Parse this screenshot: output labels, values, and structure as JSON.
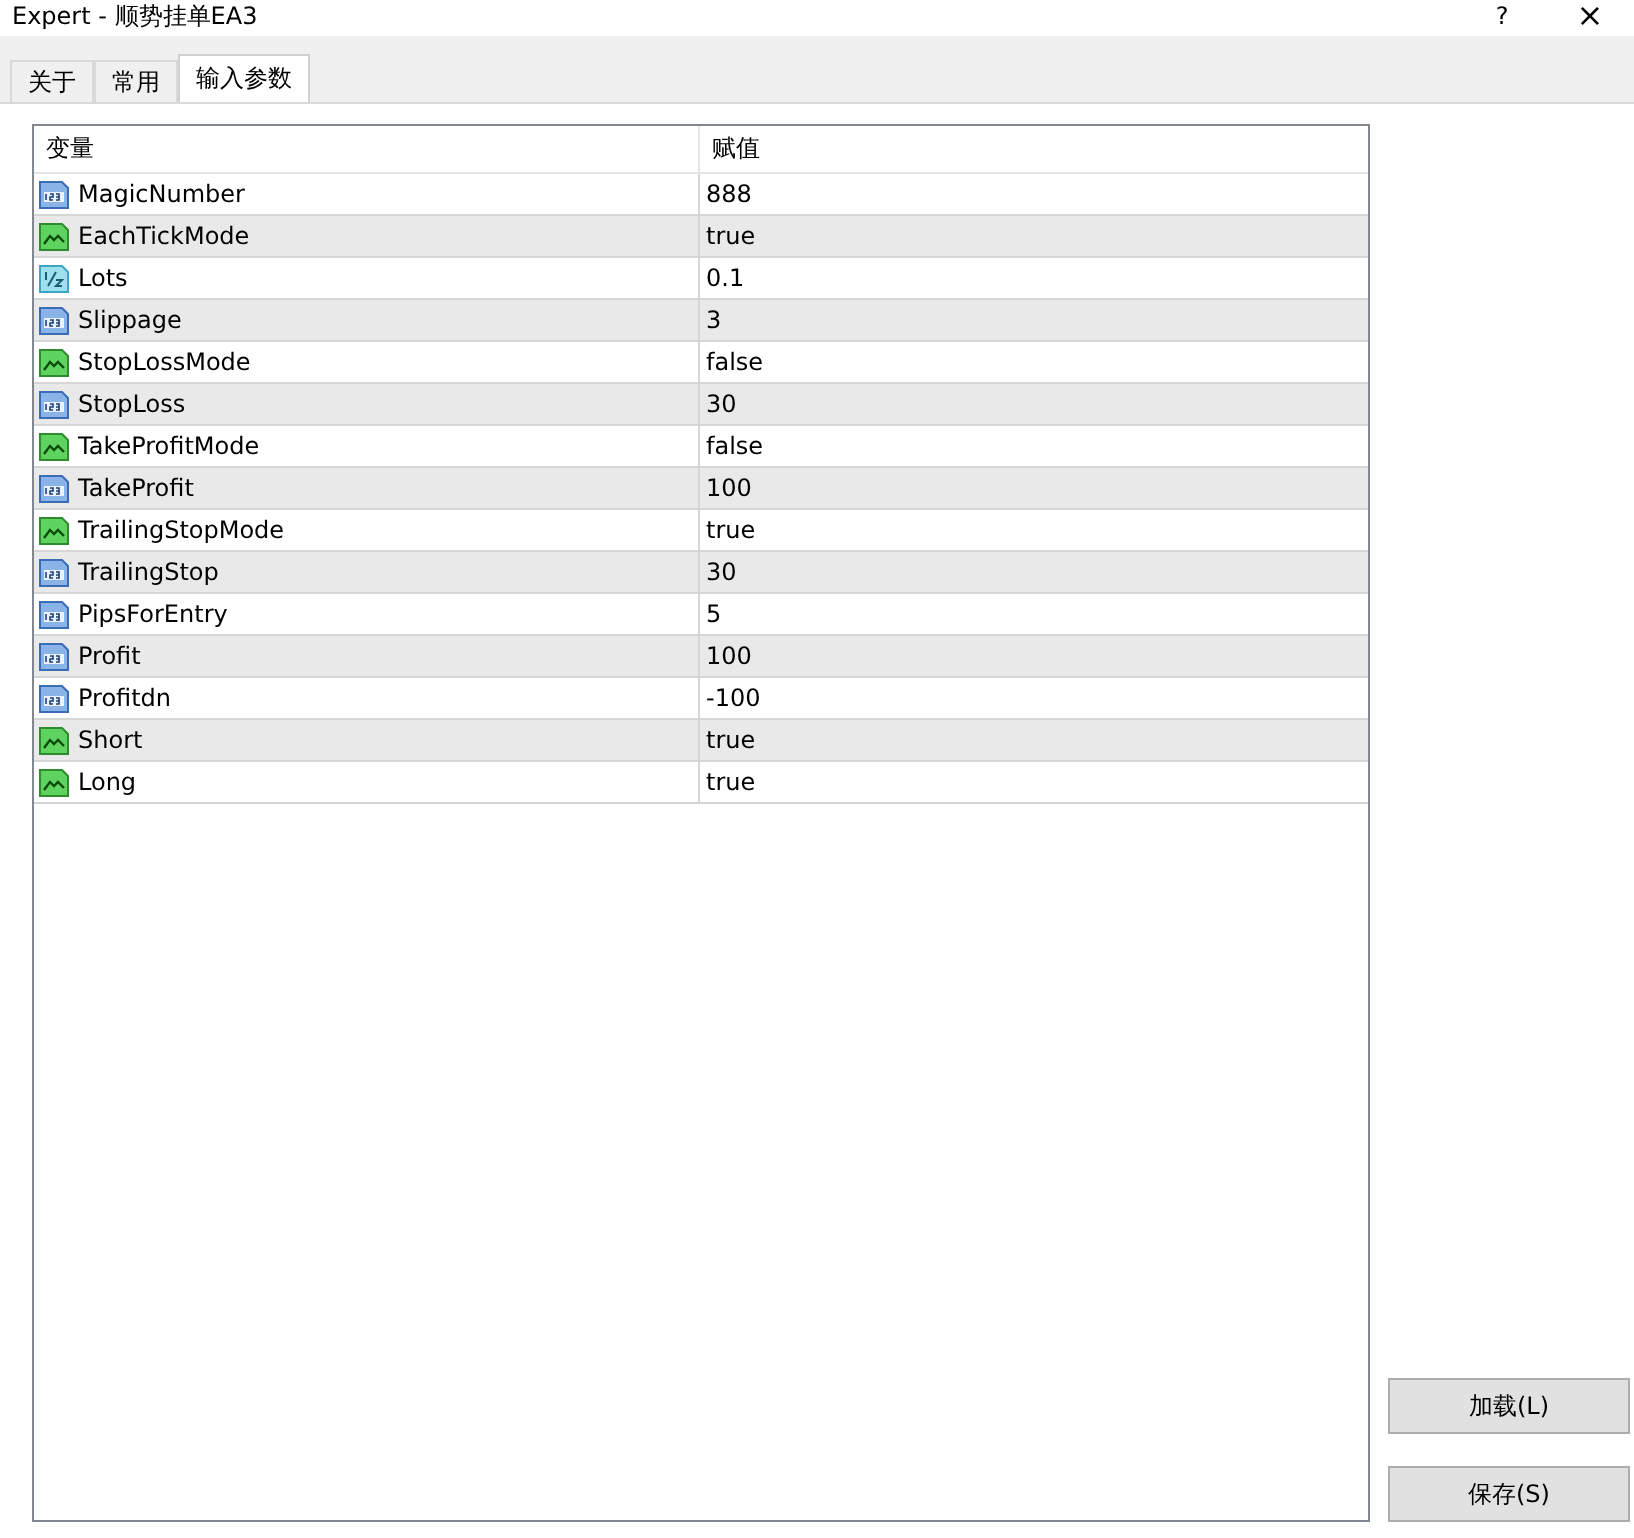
{
  "window": {
    "title": "Expert - 顺势挂单EA3",
    "help": "?",
    "close": "×"
  },
  "tabs": [
    {
      "label": "关于",
      "selected": false
    },
    {
      "label": "常用",
      "selected": false
    },
    {
      "label": "输入参数",
      "selected": true
    }
  ],
  "table": {
    "columns": [
      "变量",
      "赋值"
    ],
    "rows": [
      {
        "kind": "int",
        "name": "MagicNumber",
        "value": "888"
      },
      {
        "kind": "bool",
        "name": "EachTickMode",
        "value": "true"
      },
      {
        "kind": "double",
        "name": "Lots",
        "value": "0.1"
      },
      {
        "kind": "int",
        "name": "Slippage",
        "value": "3"
      },
      {
        "kind": "bool",
        "name": "StopLossMode",
        "value": "false"
      },
      {
        "kind": "int",
        "name": "StopLoss",
        "value": "30"
      },
      {
        "kind": "bool",
        "name": "TakeProfitMode",
        "value": "false"
      },
      {
        "kind": "int",
        "name": "TakeProfit",
        "value": "100"
      },
      {
        "kind": "bool",
        "name": "TrailingStopMode",
        "value": "true"
      },
      {
        "kind": "int",
        "name": "TrailingStop",
        "value": "30"
      },
      {
        "kind": "int",
        "name": "PipsForEntry",
        "value": "5"
      },
      {
        "kind": "int",
        "name": "Profit",
        "value": "100"
      },
      {
        "kind": "int",
        "name": "Profitdn",
        "value": "-100"
      },
      {
        "kind": "bool",
        "name": "Short",
        "value": "true"
      },
      {
        "kind": "bool",
        "name": "Long",
        "value": "true"
      }
    ]
  },
  "buttons": [
    "加载(L)",
    "保存(S)"
  ]
}
